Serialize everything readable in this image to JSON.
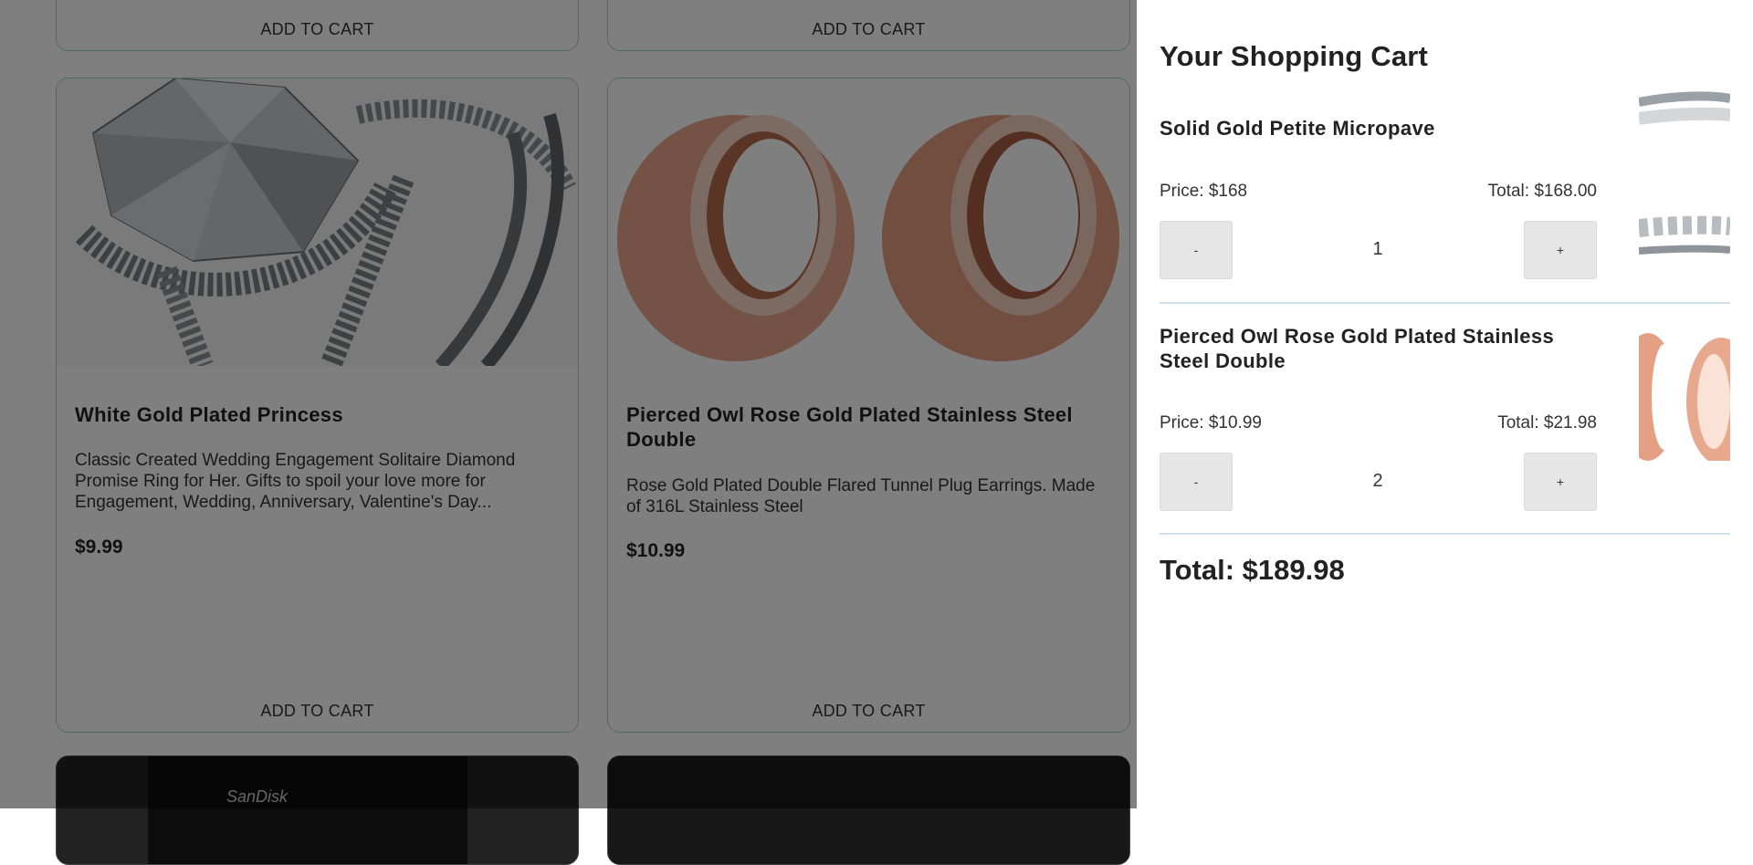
{
  "products": [
    {
      "title": "",
      "description": "",
      "price": "",
      "add_to_cart_label": "ADD TO CART"
    },
    {
      "title": "",
      "description": "",
      "price": "",
      "add_to_cart_label": "ADD TO CART"
    },
    {
      "title": "White Gold Plated Princess",
      "description": "Classic Created Wedding Engagement Solitaire Diamond Promise Ring for Her. Gifts to spoil your love more for Engagement, Wedding, Anniversary, Valentine's Day...",
      "price": "$9.99",
      "add_to_cart_label": "ADD TO CART"
    },
    {
      "title": "Pierced Owl Rose Gold Plated Stainless Steel Double",
      "description": "Rose Gold Plated Double Flared Tunnel Plug Earrings. Made of 316L Stainless Steel",
      "price": "$10.99",
      "add_to_cart_label": "ADD TO CART"
    },
    {
      "image_text": "SanDisk"
    }
  ],
  "cart": {
    "heading": "Your Shopping Cart",
    "items": [
      {
        "name": "Solid Gold Petite Micropave",
        "price_label": "Price: $168",
        "total_label": "Total: $168.00",
        "decrement_label": "-",
        "quantity": "1",
        "increment_label": "+"
      },
      {
        "name": "Pierced Owl Rose Gold Plated Stainless Steel Double",
        "price_label": "Price: $10.99",
        "total_label": "Total: $21.98",
        "decrement_label": "-",
        "quantity": "2",
        "increment_label": "+"
      }
    ],
    "total_label": "Total: $189.98"
  },
  "colors": {
    "overlay": "rgba(0,0,0,0.5)",
    "card_border": "#9fd3c4",
    "button_bg": "#e6e6e6",
    "divider": "#cfe0ec"
  },
  "icons": [
    "ring-image",
    "tunnel-plug-image",
    "sandisk-card-image"
  ]
}
